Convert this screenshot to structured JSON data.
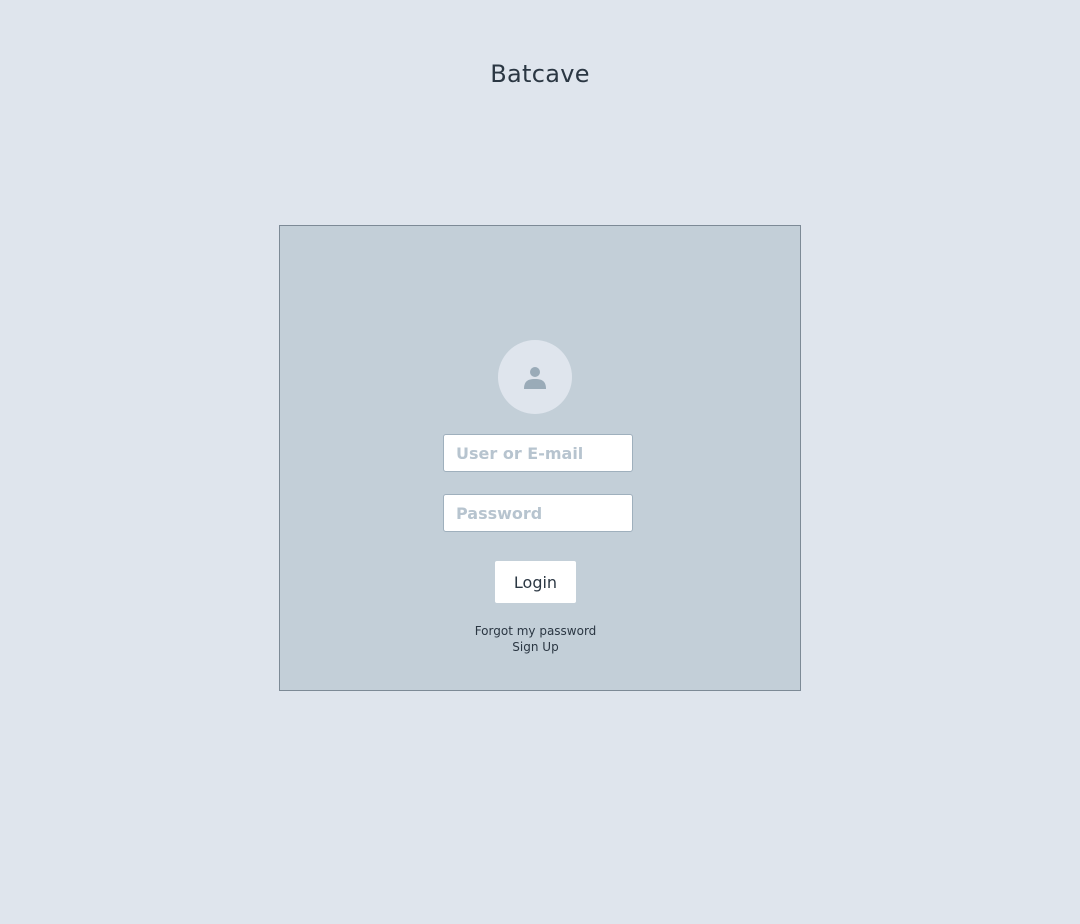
{
  "app": {
    "title": "Batcave"
  },
  "login": {
    "avatar_icon": "user-icon",
    "username": {
      "placeholder": "User or E-mail",
      "value": ""
    },
    "password": {
      "placeholder": "Password",
      "value": ""
    },
    "login_label": "Login",
    "forgot_password_label": "Forgot my password",
    "sign_up_label": "Sign Up"
  },
  "colors": {
    "page_background": "#dfe5ed",
    "panel_background": "#c3cfd8",
    "panel_border": "#7d8a96",
    "text": "#2b3743",
    "placeholder": "#b7c4cf",
    "icon": "#9aabb8"
  }
}
